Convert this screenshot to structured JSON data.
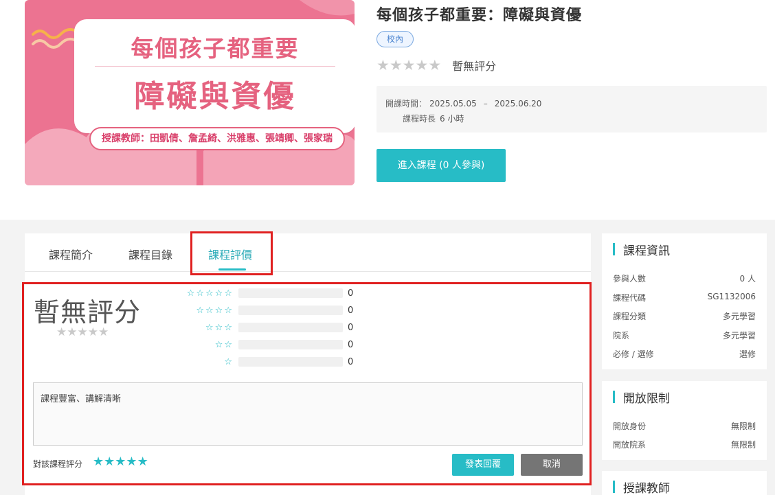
{
  "course": {
    "title": "每個孩子都重要：障礙與資優",
    "badge": "校內",
    "rating_label": "暫無評分",
    "period_label": "開課時間：",
    "start": "2025.05.05",
    "dash": "–",
    "end": "2025.06.20",
    "duration_label": "課程時長",
    "duration_value": "6 小時",
    "enter_button": "進入課程 (0 人參與)",
    "cover": {
      "line1": "每個孩子都重要",
      "line2": "障礙與資優",
      "teachers": "授課教師：田凱倩、詹孟綺、洪雅惠、張靖卿、張家瑞"
    }
  },
  "tabs": [
    {
      "label": "課程簡介"
    },
    {
      "label": "課程目錄"
    },
    {
      "label": "課程評價"
    }
  ],
  "active_tab": 2,
  "review": {
    "score_label": "暫無評分",
    "distribution": [
      {
        "stars": 5,
        "count": "0"
      },
      {
        "stars": 4,
        "count": "0"
      },
      {
        "stars": 3,
        "count": "0"
      },
      {
        "stars": 2,
        "count": "0"
      },
      {
        "stars": 1,
        "count": "0"
      }
    ],
    "comment_value": "課程豐富、講解清晰",
    "rate_label": "對該課程評分",
    "user_rating": 5,
    "submit_button": "發表回覆",
    "cancel_button": "取消"
  },
  "sidebar": {
    "course_info": {
      "title": "課程資訊",
      "rows": [
        {
          "label": "參與人數",
          "value": "0 人"
        },
        {
          "label": "課程代碼",
          "value": "SG1132006"
        },
        {
          "label": "課程分類",
          "value": "多元學習"
        },
        {
          "label": "院系",
          "value": "多元學習"
        },
        {
          "label": "必修 / 選修",
          "value": "選修"
        }
      ]
    },
    "restrictions": {
      "title": "開放限制",
      "rows": [
        {
          "label": "開放身份",
          "value": "無限制"
        },
        {
          "label": "開放院系",
          "value": "無限制"
        }
      ]
    },
    "teachers": {
      "title": "授課教師"
    }
  },
  "colors": {
    "accent": "#27bcc6",
    "highlight": "#e02020",
    "cover_pink": "#ec7391"
  },
  "icons": {
    "empty_star": "star-outline-icon",
    "filled_star": "star-filled-icon"
  }
}
